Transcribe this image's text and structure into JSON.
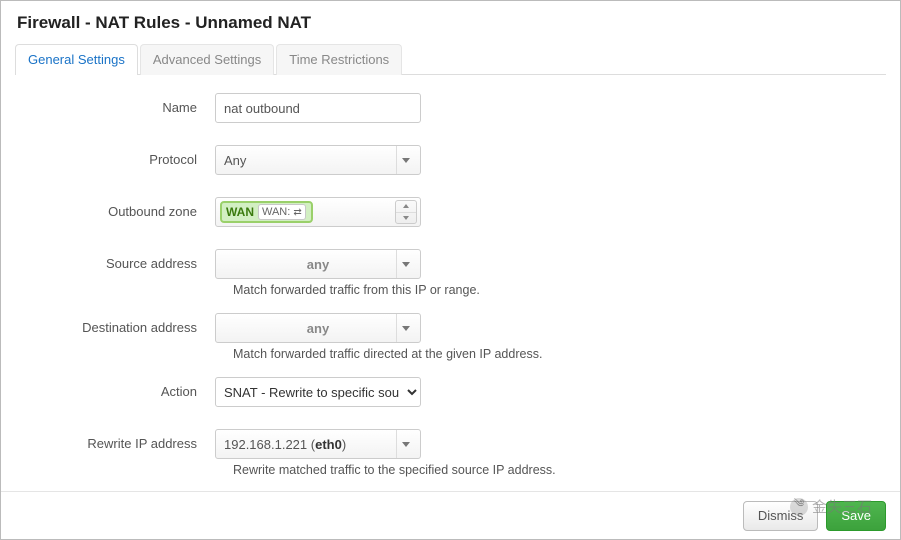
{
  "header": {
    "title": "Firewall - NAT Rules - Unnamed NAT"
  },
  "tabs": [
    {
      "id": "general",
      "label": "General Settings",
      "active": true
    },
    {
      "id": "advanced",
      "label": "Advanced Settings",
      "active": false
    },
    {
      "id": "time",
      "label": "Time Restrictions",
      "active": false
    }
  ],
  "form": {
    "name": {
      "label": "Name",
      "value": "nat outbound"
    },
    "protocol": {
      "label": "Protocol",
      "value": "Any"
    },
    "outbound_zone": {
      "label": "Outbound zone",
      "zone_name": "WAN",
      "iface_label": "WAN:",
      "iface_icon": "⇄"
    },
    "src_addr": {
      "label": "Source address",
      "value": "any",
      "hint": "Match forwarded traffic from this IP or range."
    },
    "dst_addr": {
      "label": "Destination address",
      "value": "any",
      "hint": "Match forwarded traffic directed at the given IP address."
    },
    "action": {
      "label": "Action",
      "value": "SNAT - Rewrite to specific source IP or port"
    },
    "rewrite_ip": {
      "label": "Rewrite IP address",
      "ip": "192.168.1.221",
      "iface": "eth0",
      "hint": "Rewrite matched traffic to the specified source IP address."
    }
  },
  "footer": {
    "dismiss": "Dismiss",
    "save": "Save"
  },
  "watermark": {
    "text": "金失三石"
  }
}
